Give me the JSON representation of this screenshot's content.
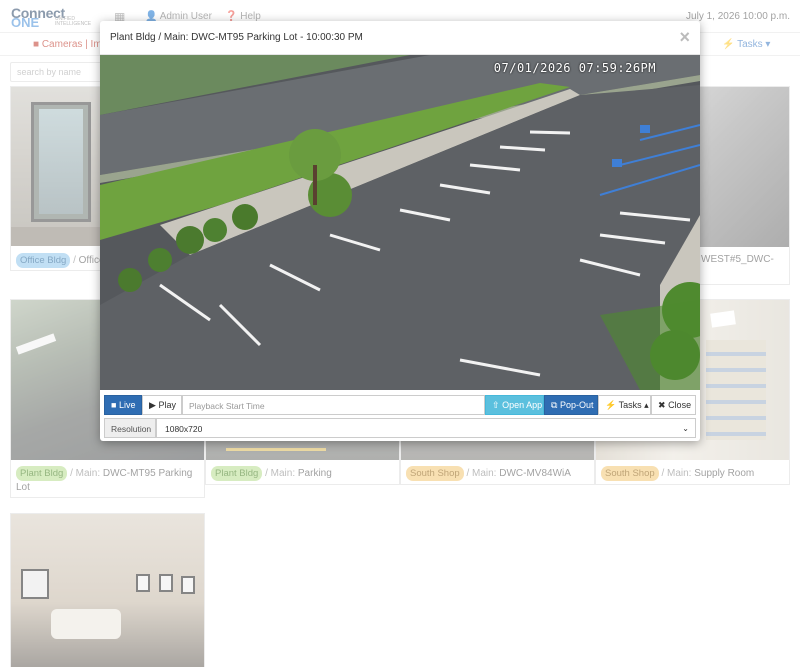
{
  "header": {
    "logo": {
      "line1": "Connect",
      "line2a": "ONE",
      "line2b": "®",
      "tagline": "UNIFIED INTELLIGENCE"
    },
    "user_label": "Admin User",
    "help_label": "Help",
    "datetime": "July 1, 2026 10:00 p.m."
  },
  "subnav": {
    "cameras_label": "Cameras | Im",
    "tasks_label": "Tasks"
  },
  "search": {
    "placeholder": "search by name"
  },
  "tiles": [
    {
      "location": "Office Bldg",
      "camera": "Office",
      "badge": "blue"
    },
    {
      "location": "",
      "camera": "WEST#5_DWC-",
      "badge": ""
    },
    {
      "location": "Plant Bldg",
      "camera": "DWC-MT95 Parking Lot",
      "badge": "green"
    },
    {
      "location": "Plant Bldg",
      "camera": "Parking",
      "badge": "green"
    },
    {
      "location": "South Shop",
      "camera": "DWC-MV84WiA",
      "badge": "orange"
    },
    {
      "location": "South Shop",
      "camera": "Supply Room",
      "badge": "orange"
    }
  ],
  "caption_sep": "/ Main:",
  "caption_sep_short": "/",
  "modal": {
    "title": "Plant Bldg / Main: DWC-MT95 Parking Lot - 10:00:30 PM",
    "close_glyph": "×",
    "timestamp": "07/01/2026 07:59:26PM",
    "controls": {
      "live": "Live",
      "play": "Play",
      "playback_placeholder": "Playback Start Time",
      "open_app": "Open App",
      "pop_out": "Pop-Out",
      "tasks": "Tasks",
      "close": "Close"
    },
    "resolution_label": "Resolution",
    "resolution_value": "1080x720"
  },
  "colors": {
    "primary": "#2f6db3",
    "info": "#5bc0de",
    "cameras_red": "#c0392b"
  }
}
